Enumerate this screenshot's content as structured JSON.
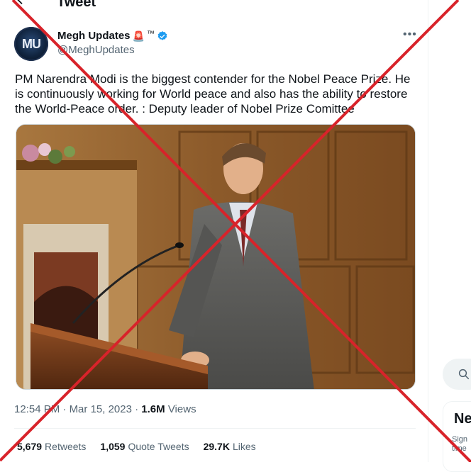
{
  "header": {
    "title": "Tweet"
  },
  "author": {
    "avatar_text": "MU",
    "name": "Megh Updates",
    "emoji": "🚨",
    "tm": "™",
    "handle": "@MeghUpdates"
  },
  "tweet": {
    "text": "PM Narendra Modi is the biggest contender for the Nobel Peace Prize. He is continuously working for World peace and also has the ability to restore the World-Peace order. : Deputy leader of Nobel Prize Comittee",
    "time": "12:54 PM",
    "date": "Mar 15, 2023",
    "views_count": "1.6M",
    "views_label": "Views"
  },
  "stats": {
    "retweets_count": "5,679",
    "retweets_label": "Retweets",
    "quotes_count": "1,059",
    "quotes_label": "Quote Tweets",
    "likes_count": "29.7K",
    "likes_label": "Likes"
  },
  "sidebar": {
    "news_heading": "Ne",
    "news_sub": "Sign time"
  },
  "colors": {
    "accent": "#1d9bf0",
    "cross": "#d8232a",
    "secondary_text": "#536471"
  }
}
